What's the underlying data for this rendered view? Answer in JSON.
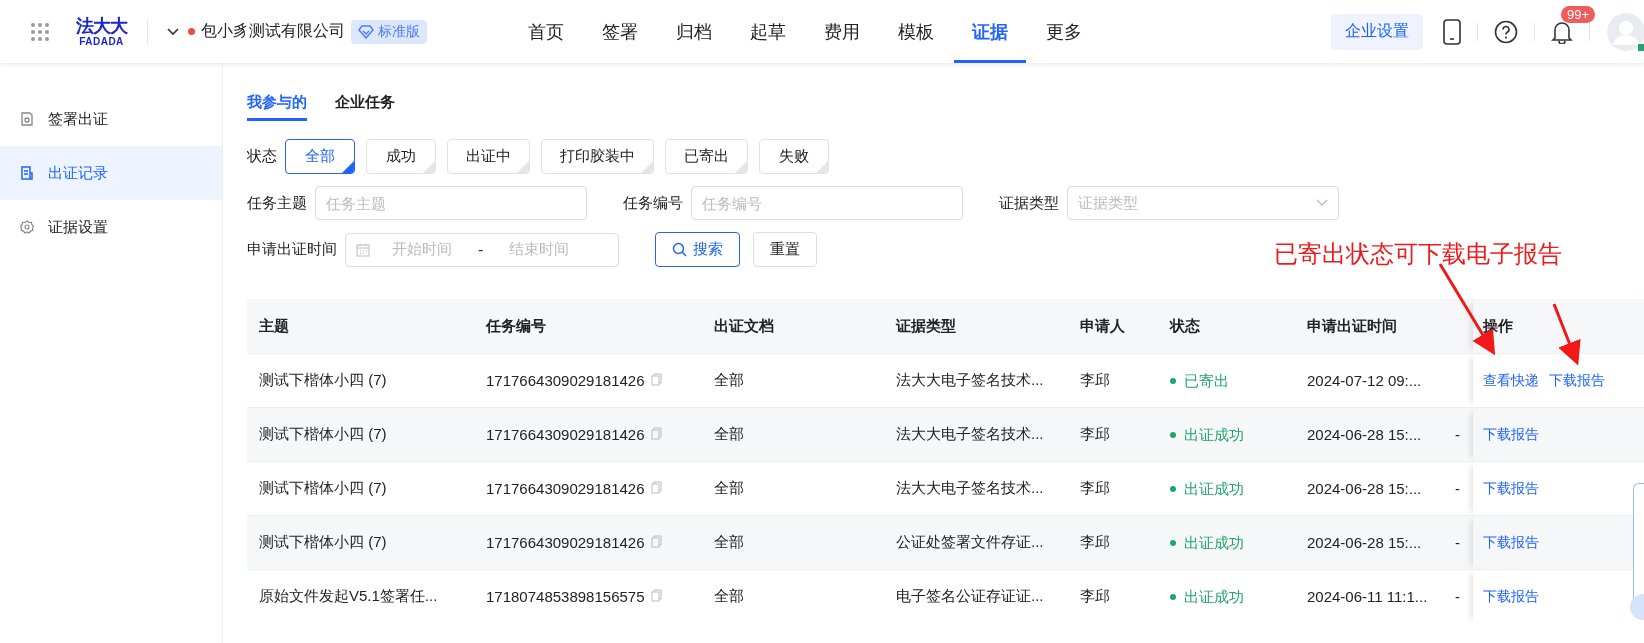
{
  "header": {
    "logo": "法大大",
    "logo_sub": "FADADA",
    "company": "包小豸测试有限公司",
    "edition": "标准版",
    "nav": [
      {
        "label": "首页",
        "selected": false
      },
      {
        "label": "签署",
        "selected": false
      },
      {
        "label": "归档",
        "selected": false
      },
      {
        "label": "起草",
        "selected": false
      },
      {
        "label": "费用",
        "selected": false
      },
      {
        "label": "模板",
        "selected": false
      },
      {
        "label": "证据",
        "selected": true
      },
      {
        "label": "更多",
        "selected": false
      }
    ],
    "settings_button": "企业设置",
    "notification_badge": "99+"
  },
  "sidebar": {
    "items": [
      {
        "label": "签署出证",
        "kind": "doc",
        "selected": false
      },
      {
        "label": "出证记录",
        "kind": "record",
        "selected": true
      },
      {
        "label": "证据设置",
        "kind": "gear",
        "selected": false
      }
    ]
  },
  "tabs": [
    {
      "label": "我参与的",
      "selected": true
    },
    {
      "label": "企业任务",
      "selected": false
    }
  ],
  "filters": {
    "status_label": "状态",
    "status_options": [
      {
        "label": "全部",
        "selected": true
      },
      {
        "label": "成功",
        "selected": false
      },
      {
        "label": "出证中",
        "selected": false
      },
      {
        "label": "打印胶装中",
        "selected": false
      },
      {
        "label": "已寄出",
        "selected": false
      },
      {
        "label": "失败",
        "selected": false
      }
    ],
    "fields": [
      {
        "label": "任务主题",
        "placeholder": "任务主题",
        "kind": "text"
      },
      {
        "label": "任务编号",
        "placeholder": "任务编号",
        "kind": "text"
      },
      {
        "label": "证据类型",
        "placeholder": "证据类型",
        "kind": "select"
      }
    ],
    "date": {
      "label": "申请出证时间",
      "start_placeholder": "开始时间",
      "separator": "-",
      "end_placeholder": "结束时间"
    },
    "search_button": "搜索",
    "reset_button": "重置"
  },
  "table": {
    "columns": [
      "主题",
      "任务编号",
      "出证文档",
      "证据类型",
      "申请人",
      "状态",
      "申请出证时间",
      "操作"
    ],
    "rows": [
      {
        "subject": "测试下楷体小四 (7)",
        "task_no": "1717664309029181426",
        "document": "全部",
        "evidence_type": "法大大电子签名技术...",
        "applicant": "李邱",
        "status": "已寄出",
        "time": "2024-07-12 09:...",
        "actions": [
          "查看快递",
          "下载报告"
        ]
      },
      {
        "subject": "测试下楷体小四 (7)",
        "task_no": "1717664309029181426",
        "document": "全部",
        "evidence_type": "法大大电子签名技术...",
        "applicant": "李邱",
        "status": "出证成功",
        "time": "2024-06-28 15:...",
        "column_8": "-",
        "actions": [
          "下载报告"
        ]
      },
      {
        "subject": "测试下楷体小四 (7)",
        "task_no": "1717664309029181426",
        "document": "全部",
        "evidence_type": "法大大电子签名技术...",
        "applicant": "李邱",
        "status": "出证成功",
        "time": "2024-06-28 15:...",
        "column_8": "-",
        "actions": [
          "下载报告"
        ]
      },
      {
        "subject": "测试下楷体小四 (7)",
        "task_no": "1717664309029181426",
        "document": "全部",
        "evidence_type": "公证处签署文件存证...",
        "applicant": "李邱",
        "status": "出证成功",
        "time": "2024-06-28 15:...",
        "column_8": "-",
        "actions": [
          "下载报告"
        ]
      },
      {
        "subject": "原始文件发起V5.1签署任...",
        "task_no": "1718074853898156575",
        "document": "全部",
        "evidence_type": "电子签名公证存证证...",
        "applicant": "李邱",
        "status": "出证成功",
        "time": "2024-06-11 11:1...",
        "column_8": "-",
        "actions": [
          "下载报告"
        ]
      }
    ]
  },
  "annotation": {
    "text": "已寄出状态可下载电子报告"
  }
}
